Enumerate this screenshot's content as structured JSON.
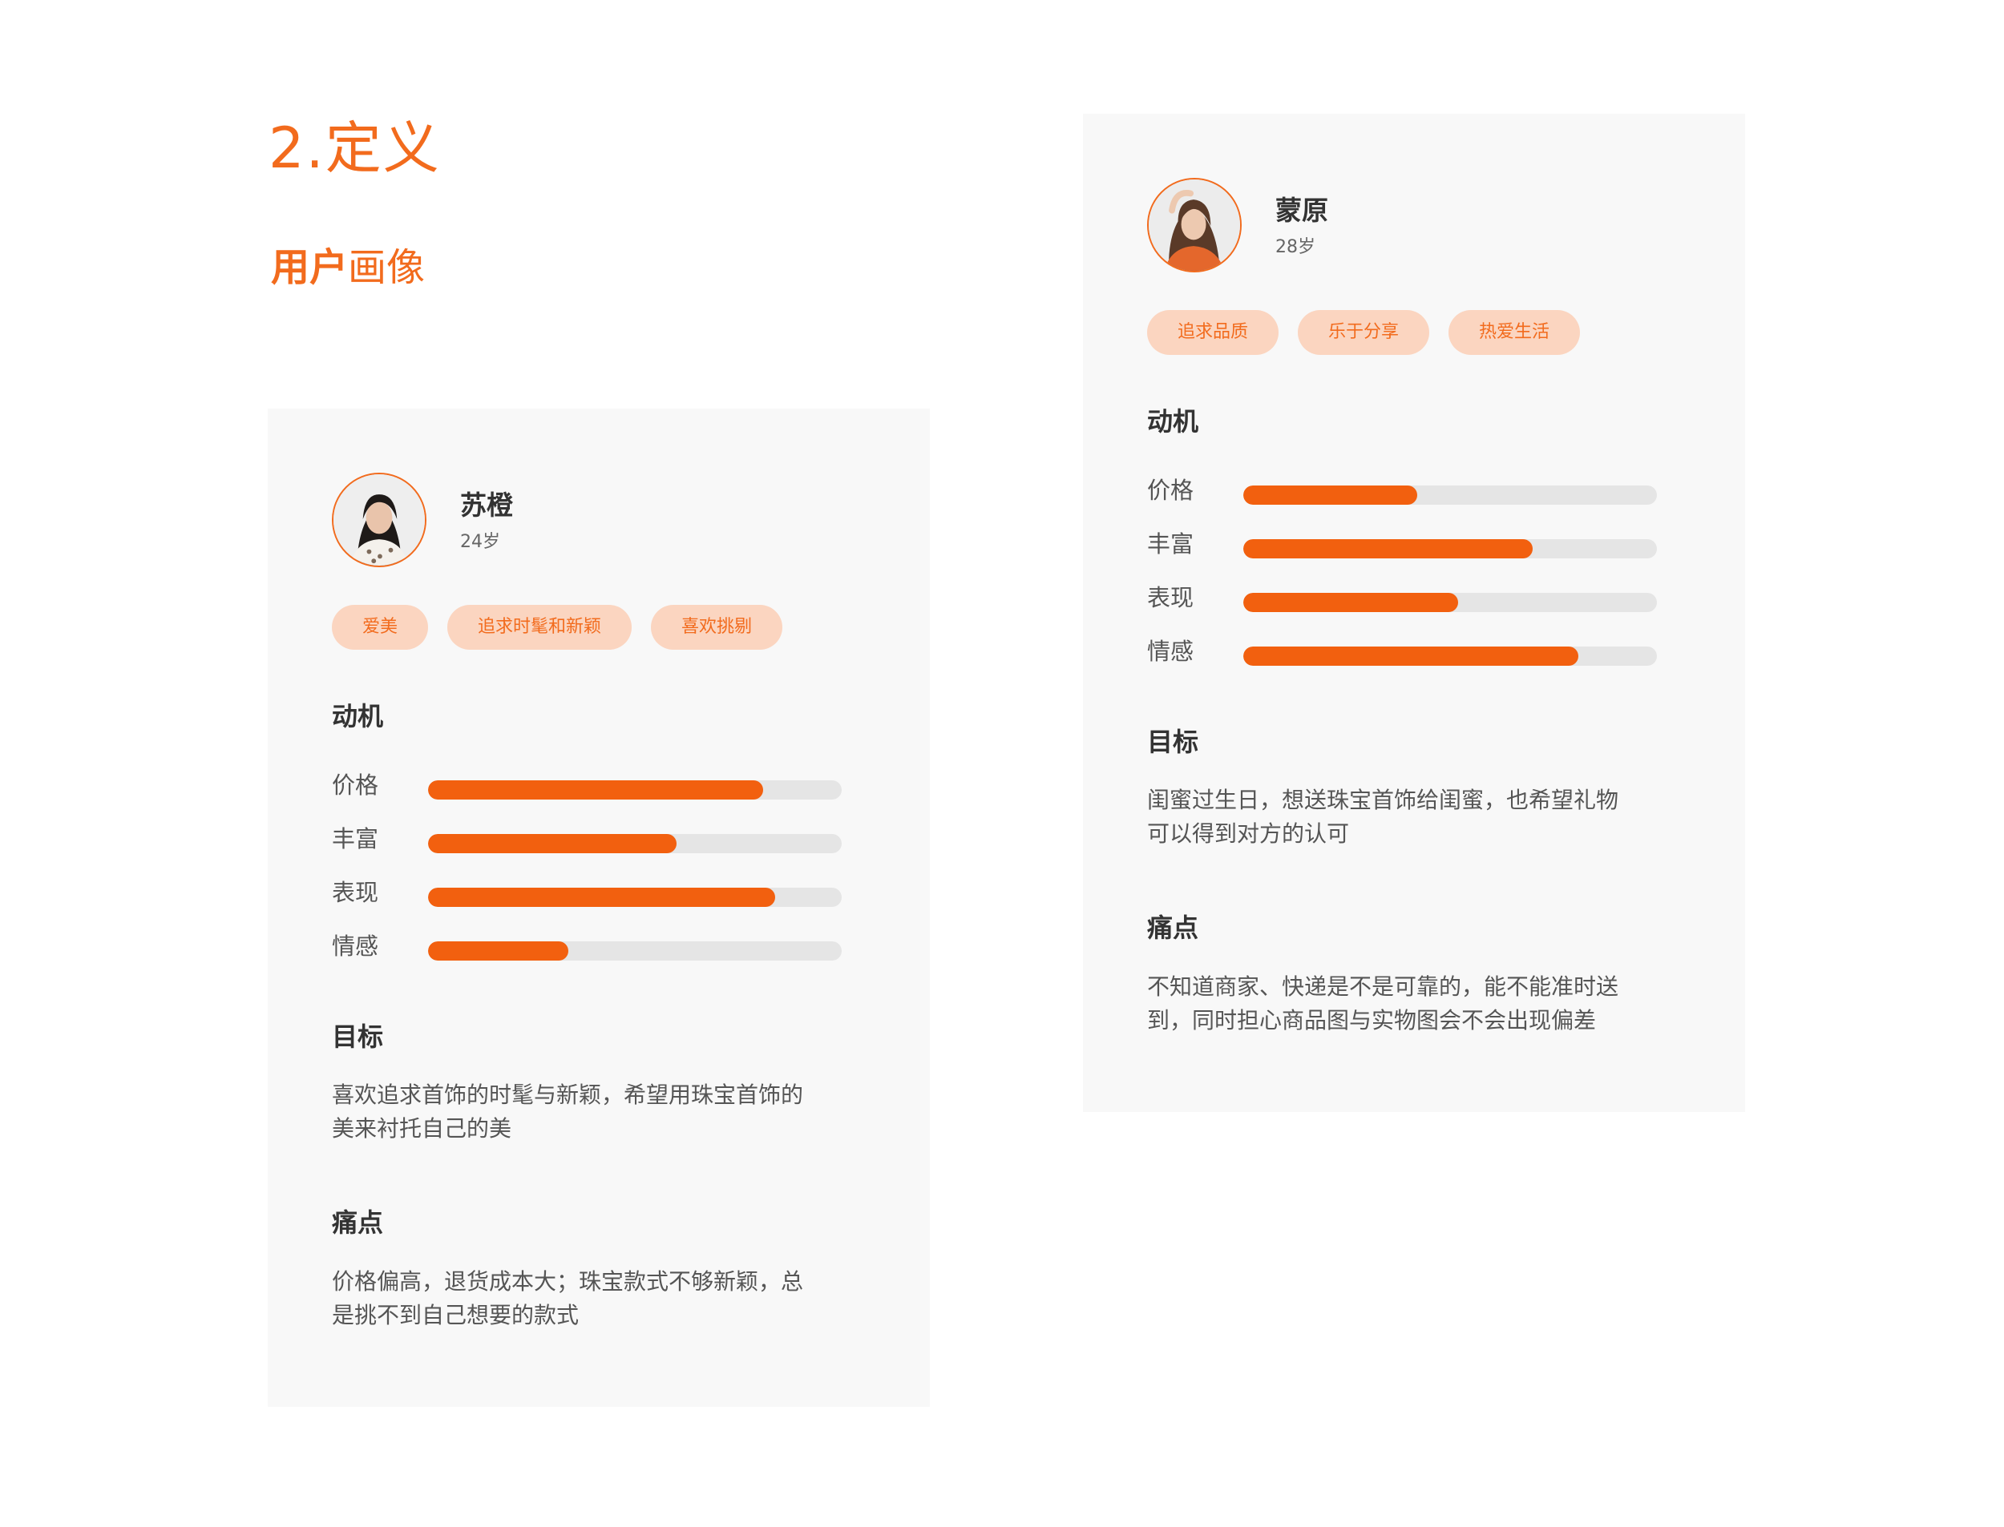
{
  "section_title": "2.定义",
  "subtitle": {
    "bold": "用户",
    "normal": "画像"
  },
  "personas": [
    {
      "name": "苏橙",
      "age": "24岁",
      "tags": [
        "爱美",
        "追求时髦和新颖",
        "喜欢挑剔"
      ],
      "motivation": {
        "heading": "动机",
        "items": [
          {
            "label": "价格",
            "value": 0.81
          },
          {
            "label": "丰富",
            "value": 0.6
          },
          {
            "label": "表现",
            "value": 0.84
          },
          {
            "label": "情感",
            "value": 0.34
          }
        ]
      },
      "goal": {
        "heading": "目标",
        "lines": [
          "喜欢追求首饰的时髦与新颖，希望用珠宝首饰的",
          "美来衬托自己的美"
        ]
      },
      "pain": {
        "heading": "痛点",
        "lines": [
          "价格偏高，退货成本大；珠宝款式不够新颖，总",
          "是挑不到自己想要的款式"
        ]
      }
    },
    {
      "name": "蒙原",
      "age": "28岁",
      "tags": [
        "追求品质",
        "乐于分享",
        "热爱生活"
      ],
      "motivation": {
        "heading": "动机",
        "items": [
          {
            "label": "价格",
            "value": 0.42
          },
          {
            "label": "丰富",
            "value": 0.7
          },
          {
            "label": "表现",
            "value": 0.52
          },
          {
            "label": "情感",
            "value": 0.81
          }
        ]
      },
      "goal": {
        "heading": "目标",
        "lines": [
          "闺蜜过生日，想送珠宝首饰给闺蜜，也希望礼物",
          "可以得到对方的认可"
        ]
      },
      "pain": {
        "heading": "痛点",
        "lines": [
          "不知道商家、快递是不是可靠的，能不能准时送",
          "到，同时担心商品图与实物图会不会出现偏差"
        ]
      }
    }
  ],
  "colors": {
    "accent": "#f26b1d",
    "bar": "#f2600f",
    "track": "#e5e5e5",
    "tag_bg": "#fbd5c0",
    "card_bg": "#f8f8f8"
  }
}
